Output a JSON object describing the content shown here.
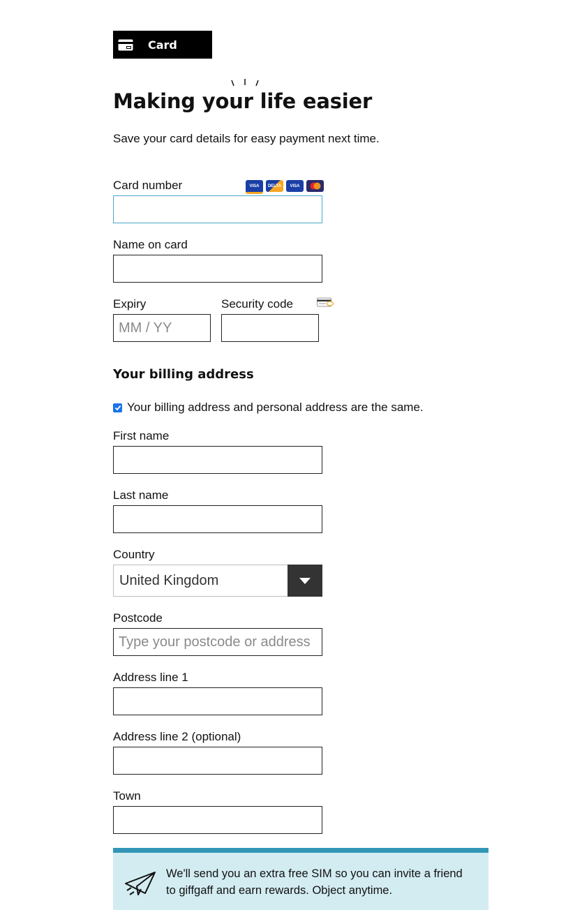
{
  "tab": {
    "label": "Card"
  },
  "heading": {
    "title": "Making your life easier",
    "subtitle": "Save your card details for easy payment next time."
  },
  "card_form": {
    "card_number_label": "Card number",
    "card_number_value": "",
    "card_logos": [
      "VISA",
      "DELTA",
      "VISA Electron",
      "MasterCard"
    ],
    "name_label": "Name on card",
    "name_value": "",
    "expiry_label": "Expiry",
    "expiry_placeholder": "MM / YY",
    "security_label": "Security code",
    "security_value": ""
  },
  "billing": {
    "heading": "Your billing address",
    "same_address_label": "Your billing address and personal address are the same.",
    "same_address_checked": true,
    "first_name_label": "First name",
    "last_name_label": "Last name",
    "country_label": "Country",
    "country_value": "United Kingdom",
    "postcode_label": "Postcode",
    "postcode_placeholder": "Type your postcode or address",
    "address1_label": "Address line 1",
    "address2_label": "Address line 2 (optional)",
    "town_label": "Town"
  },
  "promo": {
    "text": "We'll send you an extra free SIM so you can invite a friend to giffgaff and earn rewards. Object anytime."
  },
  "colors": {
    "accent_blue": "#3296b7",
    "promo_bg": "#d3ecf1",
    "focus_border": "#4aa7c9",
    "checkbox": "#1a73e8"
  }
}
